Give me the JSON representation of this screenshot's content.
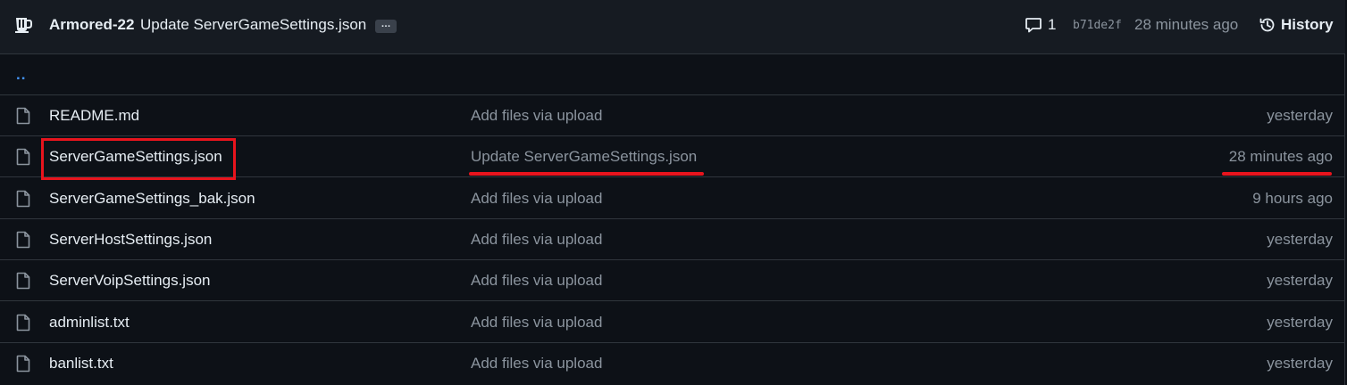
{
  "header": {
    "author": "Armored-22",
    "commit_message": "Update ServerGameSettings.json",
    "ellipsis": "…",
    "comment_count": "1",
    "sha": "b71de2f",
    "time": "28 minutes ago",
    "history_label": "History"
  },
  "parent_link": "..",
  "files": [
    {
      "name": "README.md",
      "commit": "Add files via upload",
      "time": "yesterday"
    },
    {
      "name": "ServerGameSettings.json",
      "commit": "Update ServerGameSettings.json",
      "time": "28 minutes ago"
    },
    {
      "name": "ServerGameSettings_bak.json",
      "commit": "Add files via upload",
      "time": "9 hours ago"
    },
    {
      "name": "ServerHostSettings.json",
      "commit": "Add files via upload",
      "time": "yesterday"
    },
    {
      "name": "ServerVoipSettings.json",
      "commit": "Add files via upload",
      "time": "yesterday"
    },
    {
      "name": "adminlist.txt",
      "commit": "Add files via upload",
      "time": "yesterday"
    },
    {
      "name": "banlist.txt",
      "commit": "Add files via upload",
      "time": "yesterday"
    }
  ],
  "colors": {
    "background": "#0d1117",
    "header_bg": "#161b22",
    "border": "#30363d",
    "muted_text": "#8b949e",
    "link": "#4493f8",
    "annotation": "#e8141d"
  }
}
